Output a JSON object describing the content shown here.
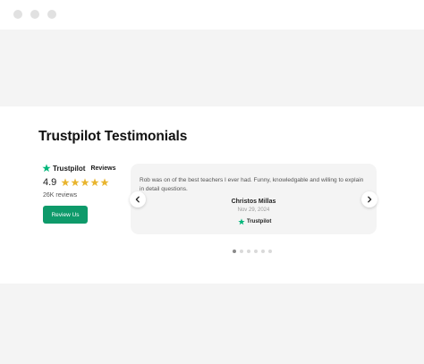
{
  "window": {
    "dots": 3
  },
  "section": {
    "title": "Trustpilot Testimonials"
  },
  "summary": {
    "brand": "Trustpilot",
    "reviews_word": "Reviews",
    "rating": "4.9",
    "stars": 5,
    "review_count": "26K reviews",
    "button_label": "Review Us"
  },
  "testimonial": {
    "text": "Rob was on of the best teachers I ever had. Funny, knowledgable and willing to explain in detail questions.",
    "author": "Christos Millas",
    "date": "Nov 29, 2024",
    "source": "Trustpilot"
  },
  "carousel": {
    "slides": 6,
    "active_index": 0
  },
  "colors": {
    "trustpilot_green": "#00b67a",
    "star_gold": "#e9b52f",
    "button_green": "#0e9a6a"
  },
  "icons": {
    "prev": "chevron-left-icon",
    "next": "chevron-right-icon",
    "brand": "trustpilot-star-icon",
    "rating": "star-icon"
  }
}
